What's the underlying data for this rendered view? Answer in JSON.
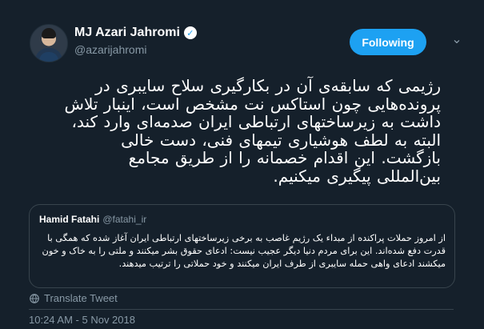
{
  "tweet": {
    "author": {
      "name": "MJ Azari Jahromi",
      "handle": "@azarijahromi",
      "verified": true
    },
    "follow_button": {
      "label": "Following"
    },
    "body": "رژیمی که سابقه‌ی آن در بکارگیری سلاح سایبری در پرونده‌هایی چون استاکس نت مشخص است، اینبار تلاش داشت به زیرساختهای ارتباطی ایران صدمه‌ای وارد کند، البته به لطف هوشیاری تیمهای فنی، دست خالی بازگشت. این اقدام خصمانه را از طریق مجامع بین‌المللی پیگیری میکنیم.",
    "quoted_tweet": {
      "author_name": "Hamid Fatahi",
      "author_handle": "@fatahi_ir",
      "body": "از امروز حملات پراکنده از مبداء یک رژیم غاصب به برخی زیرساختهای ارتباطی ایران آغاز شده که همگی با قدرت دفع شده‌اند. این برای مردم دنیا دیگر عجیب نیست: ادعای حقوق بشر میکنند و ملتی را به خاک و خون میکشند ادعای واهی حمله سایبری از طرف ایران میکنند و خود حملاتی را ترتیب میدهند."
    },
    "translate_label": "Translate Tweet",
    "timestamp": "10:24 AM - 5 Nov 2018"
  },
  "icons": {
    "verified_icon": "verified-badge",
    "dropdown_icon": "chevron-down-icon",
    "translate_icon": "globe-icon"
  },
  "colors": {
    "background": "#15202b",
    "accent": "#1da1f2",
    "secondary_text": "#8899a6",
    "border": "#38444d"
  }
}
